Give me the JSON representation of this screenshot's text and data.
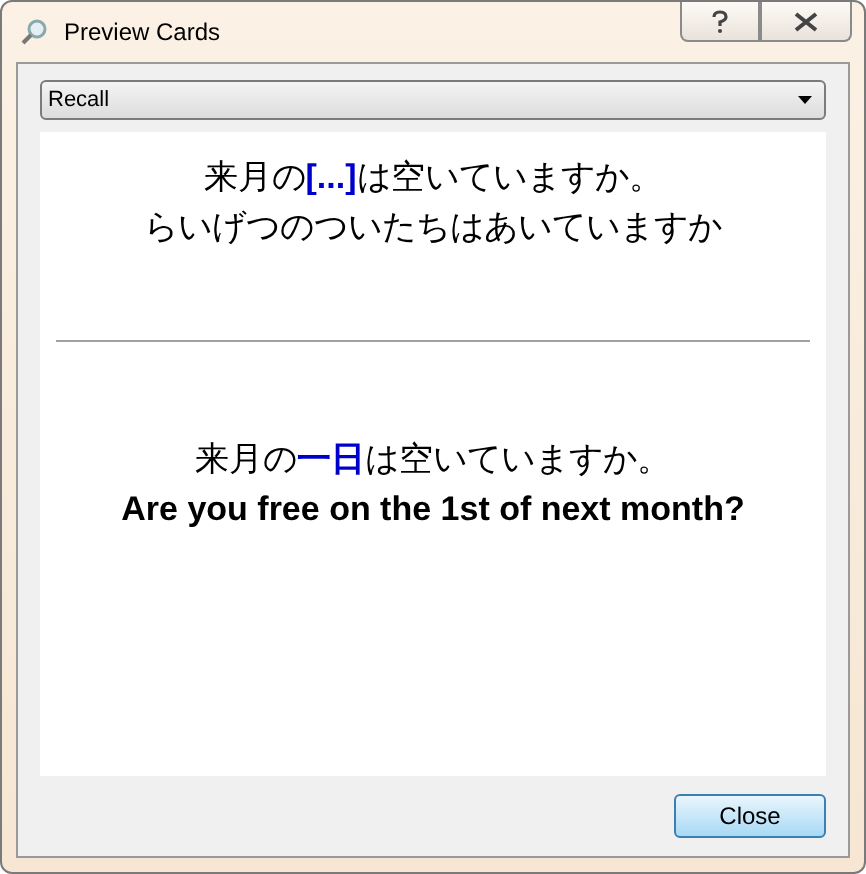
{
  "window": {
    "title": "Preview Cards"
  },
  "mode_dropdown": {
    "value": "Recall"
  },
  "question": {
    "lines": [
      {
        "segments": [
          {
            "text": "来月の",
            "highlight": false
          },
          {
            "text": "[...]",
            "highlight": true
          },
          {
            "text": "は空いていますか。",
            "highlight": false
          }
        ]
      },
      {
        "segments": [
          {
            "text": "らいげつのついたちはあいていますか",
            "highlight": false
          }
        ]
      }
    ]
  },
  "answer": {
    "lines": [
      {
        "segments": [
          {
            "text": "来月の",
            "highlight": false
          },
          {
            "text": "一日",
            "highlight": true
          },
          {
            "text": "は空いていますか。",
            "highlight": false
          }
        ]
      },
      {
        "segments": [
          {
            "text": "Are you free on the 1st of next month?",
            "highlight": false
          }
        ],
        "bold": true
      }
    ]
  },
  "buttons": [
    {
      "label": "Close"
    }
  ]
}
